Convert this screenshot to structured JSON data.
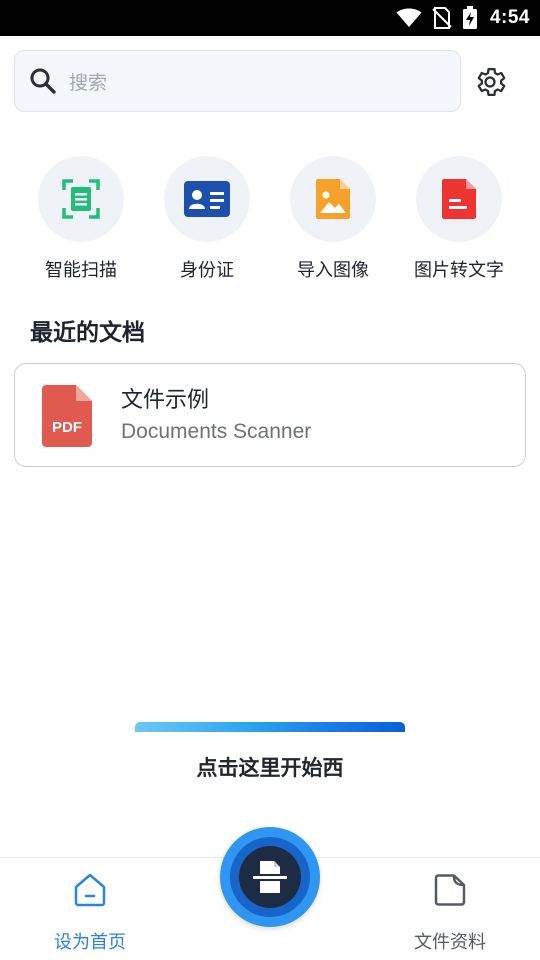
{
  "status_bar": {
    "time": "4:54",
    "icons": [
      "wifi-icon",
      "no-sim-icon",
      "battery-charging-icon"
    ]
  },
  "search": {
    "placeholder": "搜索",
    "icon": "search-icon"
  },
  "settings": {
    "icon": "gear-icon"
  },
  "quick_actions": [
    {
      "label": "智能扫描",
      "icon": "smart-scan-icon",
      "color": "#1fbf7a"
    },
    {
      "label": "身份证",
      "icon": "id-card-icon",
      "color": "#1c4fae"
    },
    {
      "label": "导入图像",
      "icon": "image-file-icon",
      "color": "#f5a12a"
    },
    {
      "label": "图片转文字",
      "icon": "text-file-icon",
      "color": "#ee3333"
    }
  ],
  "recent": {
    "title": "最近的文档",
    "docs": [
      {
        "name": "文件示例",
        "subtitle": "Documents Scanner",
        "badge": "PDF",
        "color": "#e15a4f"
      }
    ]
  },
  "hint": {
    "text": "点击这里开始西"
  },
  "bottom_nav": {
    "home_label": "设为首页",
    "files_label": "文件资料",
    "active_color": "#2a83e8",
    "inactive_color": "#555a64"
  },
  "fab": {
    "icon": "scan-document-icon",
    "color": "#2f96f2"
  }
}
